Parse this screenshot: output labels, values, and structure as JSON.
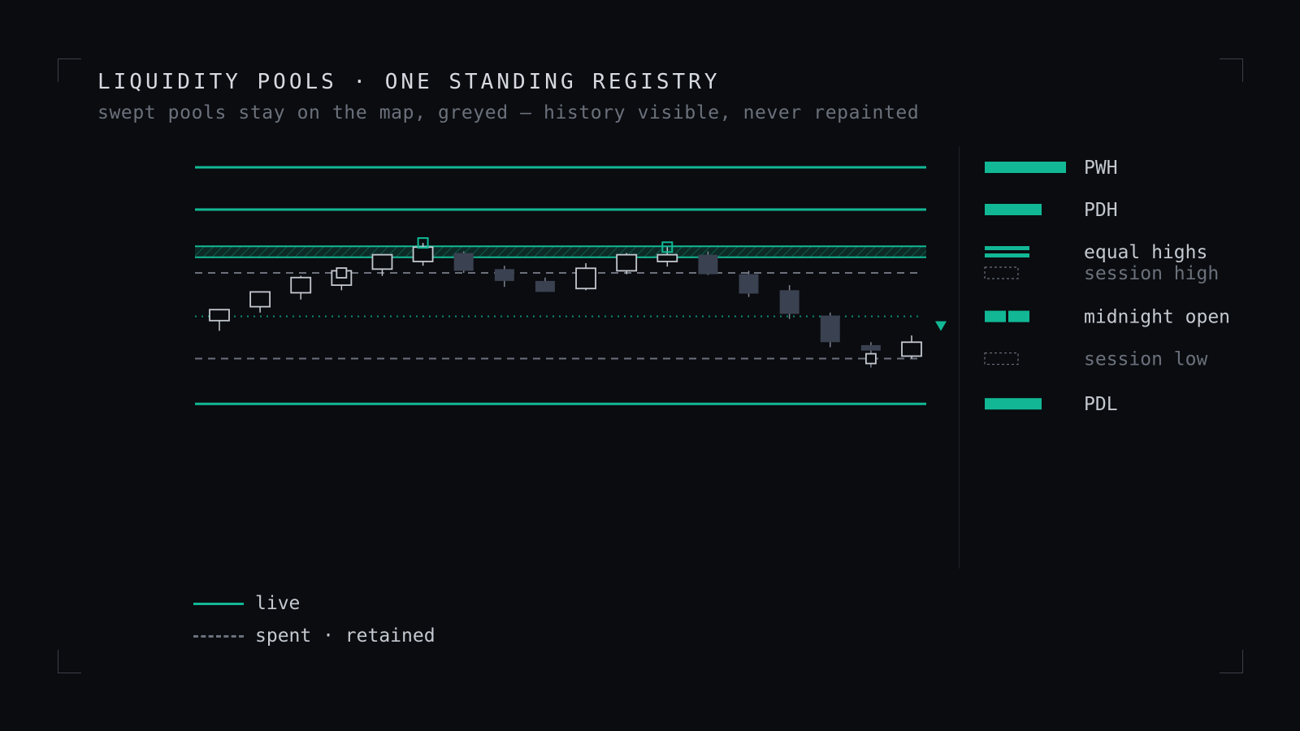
{
  "header": {
    "title": "LIQUIDITY POOLS · ONE STANDING REGISTRY",
    "subtitle": "swept pools stay on the map, greyed — history visible, never repainted"
  },
  "key": {
    "live": "live",
    "spent": "spent · retained"
  },
  "colors": {
    "live": "#12b895",
    "spent": "#6b717b",
    "bull_candle": "#c4c9d0",
    "bear_candle": "#3a4150",
    "background": "#0a0c10"
  },
  "chart_data": {
    "type": "candlestick",
    "title": "LIQUIDITY POOLS · ONE STANDING REGISTRY",
    "ylim": [
      0,
      100
    ],
    "levels": [
      {
        "name": "PWH",
        "value": 95,
        "style": "live-solid"
      },
      {
        "name": "PDH",
        "value": 85,
        "style": "live-solid"
      },
      {
        "name": "equal highs",
        "value": 76.3,
        "value_low": 73.7,
        "style": "live-zone"
      },
      {
        "name": "session high",
        "value": 70,
        "style": "spent-dashed"
      },
      {
        "name": "midnight open",
        "value": 59.7,
        "style": "live-dotted"
      },
      {
        "name": "session low",
        "value": 49.7,
        "style": "spent-dashed"
      },
      {
        "name": "PDL",
        "value": 39,
        "style": "live-solid"
      }
    ],
    "candles": [
      {
        "o": 58.7,
        "h": 61.3,
        "l": 56.3,
        "c": 61.3,
        "mark": ""
      },
      {
        "o": 62.0,
        "h": 65.5,
        "l": 60.6,
        "c": 65.5,
        "mark": ""
      },
      {
        "o": 65.3,
        "h": 69.3,
        "l": 63.7,
        "c": 68.9,
        "mark": ""
      },
      {
        "o": 67.1,
        "h": 70.5,
        "l": 65.9,
        "c": 70.5,
        "mark": "swept"
      },
      {
        "o": 70.9,
        "h": 72.7,
        "l": 69.3,
        "c": 74.3,
        "mark": ""
      },
      {
        "o": 72.7,
        "h": 77.1,
        "l": 71.7,
        "c": 76.1,
        "mark": "tagged"
      },
      {
        "o": 74.7,
        "h": 75.1,
        "l": 70.0,
        "c": 70.5,
        "mark": ""
      },
      {
        "o": 70.9,
        "h": 71.7,
        "l": 66.7,
        "c": 68.1,
        "mark": ""
      },
      {
        "o": 68.1,
        "h": 68.9,
        "l": 66.3,
        "c": 65.5,
        "mark": ""
      },
      {
        "o": 66.3,
        "h": 72.3,
        "l": 65.9,
        "c": 71.1,
        "mark": ""
      },
      {
        "o": 70.5,
        "h": 74.7,
        "l": 69.7,
        "c": 74.3,
        "mark": ""
      },
      {
        "o": 72.7,
        "h": 76.1,
        "l": 71.5,
        "c": 74.3,
        "mark": "tagged"
      },
      {
        "o": 74.3,
        "h": 75.1,
        "l": 69.5,
        "c": 69.7,
        "mark": ""
      },
      {
        "o": 69.7,
        "h": 70.5,
        "l": 64.3,
        "c": 65.1,
        "mark": ""
      },
      {
        "o": 65.9,
        "h": 67.1,
        "l": 59.1,
        "c": 60.3,
        "mark": ""
      },
      {
        "o": 59.9,
        "h": 60.6,
        "l": 52.4,
        "c": 53.6,
        "mark": ""
      },
      {
        "o": 52.9,
        "h": 53.6,
        "l": 47.6,
        "c": 51.6,
        "mark": "swept"
      },
      {
        "o": 50.3,
        "h": 55.2,
        "l": 49.7,
        "c": 53.6,
        "mark": ""
      }
    ]
  }
}
